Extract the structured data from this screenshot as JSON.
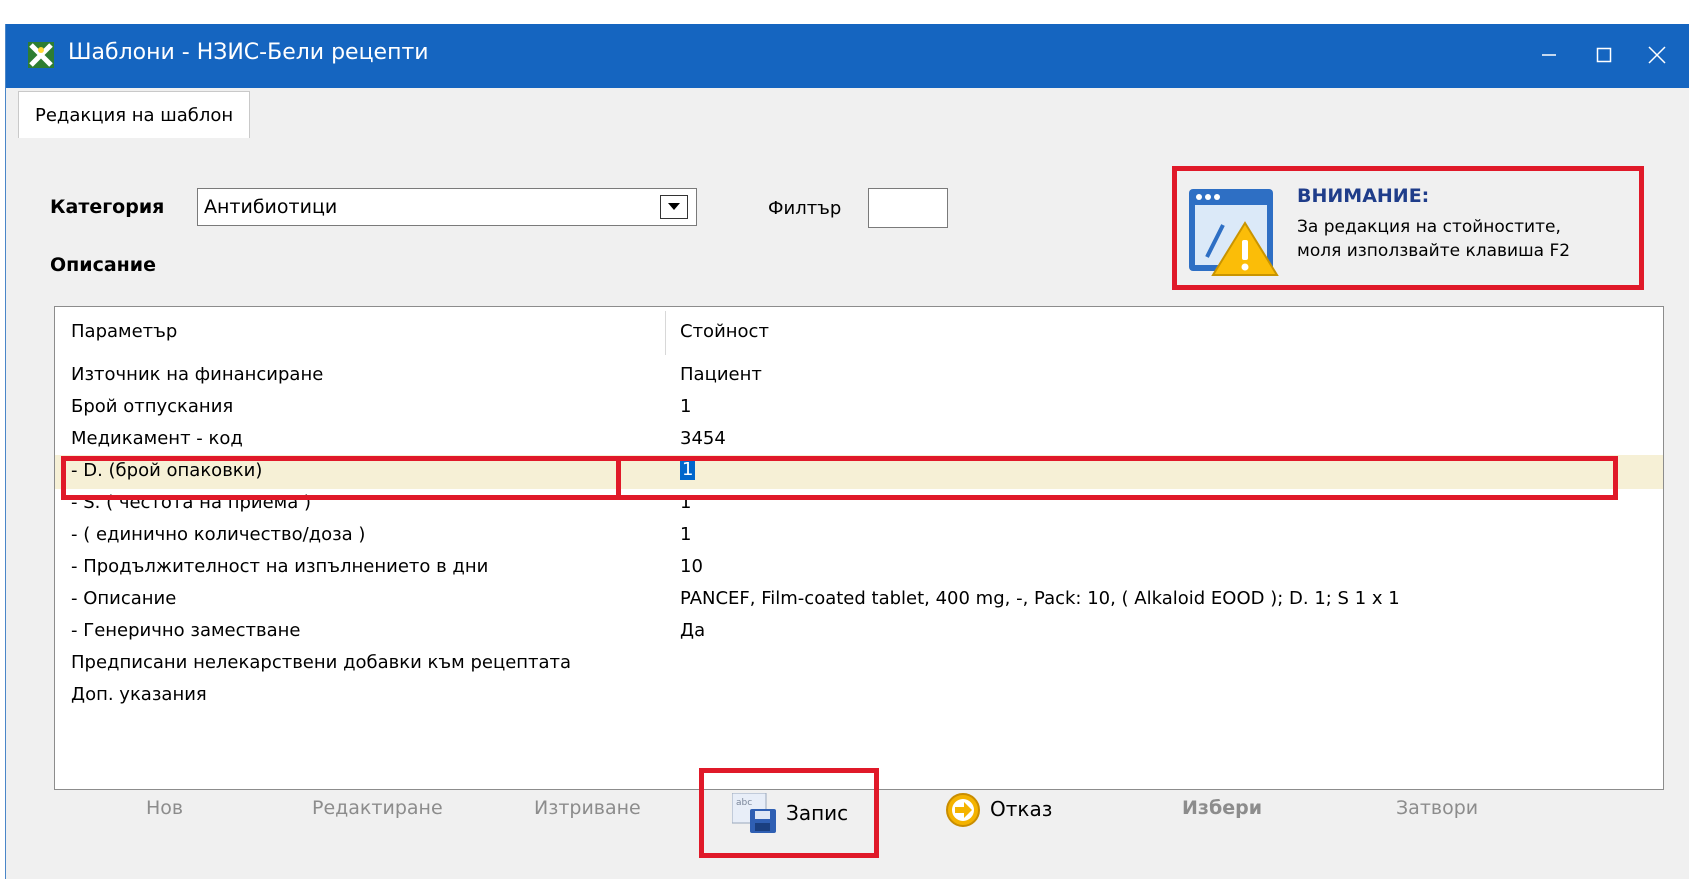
{
  "window": {
    "title": "Шаблони - НЗИС-Бели рецепти",
    "title_bar_color": "#1565c0",
    "controls": [
      "minimize-icon",
      "maximize-icon",
      "close-icon"
    ]
  },
  "tabs": [
    {
      "label": "Редакция на шаблон",
      "active": true
    }
  ],
  "form": {
    "category_label": "Категория",
    "category_value": "Антибиотици",
    "filter_label": "Филтър",
    "filter_value": "",
    "description_label": "Описание"
  },
  "warning": {
    "title": "ВНИМАНИЕ:",
    "line1": "За редакция на стойностите,",
    "line2": "моля използвайте клавиша F2",
    "icon": "warning-window-icon",
    "highlight_color": "#e01929"
  },
  "grid": {
    "headers": {
      "param": "Параметър",
      "value": "Стойност"
    },
    "rows": [
      {
        "param": "Източник на финансиране",
        "value": "Пациент"
      },
      {
        "param": "Брой отпускания",
        "value": "1"
      },
      {
        "param": "Медикамент - код",
        "value": "3454"
      },
      {
        "param": " - D. (брой опаковки)",
        "value": "1"
      },
      {
        "param": " - S. ( честота на приема )",
        "value": "1"
      },
      {
        "param": " - ( единично количество/доза )",
        "value": "1"
      },
      {
        "param": " - Продължителност на изпълнението в дни",
        "value": "10"
      },
      {
        "param": " - Описание",
        "value": "PANCEF, Film-coated tablet, 400 mg, -, Pack: 10, ( Alkaloid EOOD ); D. 1; S 1 x 1"
      },
      {
        "param": " - Генерично заместване",
        "value": "Да"
      },
      {
        "param": "Предписани нелекарствени добавки към рецептата",
        "value": ""
      },
      {
        "param": "Доп. указания",
        "value": ""
      }
    ],
    "selected_row": 3,
    "selection_color": "#0066cc"
  },
  "toolbar": {
    "new": "Нов",
    "edit": "Редактиране",
    "delete": "Изтриване",
    "save": "Запис",
    "cancel": "Отказ",
    "select": "Избери",
    "close": "Затвори"
  }
}
